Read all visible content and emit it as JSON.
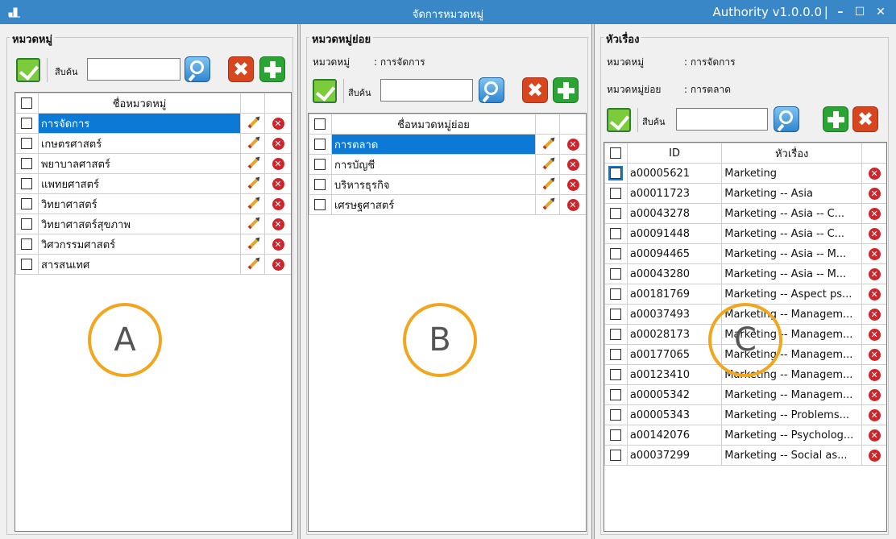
{
  "window": {
    "title": "จัดการหมวดหมู่",
    "version": "Authority v1.0.0.0",
    "separator": "|",
    "min_label": "–",
    "max_label": "☐",
    "close_label": "✕"
  },
  "panel_a": {
    "group_title": "หมวดหมู่",
    "search_label": "สืบค้น",
    "search_value": "",
    "delete_label": "✖",
    "header": "ชื่อหมวดหมู่",
    "rows": [
      {
        "name": "การจัดการ",
        "selected": true
      },
      {
        "name": "เกษตรศาสตร์"
      },
      {
        "name": "พยาบาลศาสตร์"
      },
      {
        "name": "แพทยศาสตร์"
      },
      {
        "name": "วิทยาศาสตร์"
      },
      {
        "name": "วิทยาศาสตร์สุขภาพ"
      },
      {
        "name": "วิศวกรรมศาสตร์"
      },
      {
        "name": "สารสนเทศ"
      }
    ],
    "overlay": "A"
  },
  "panel_b": {
    "group_title": "หมวดหมู่ย่อย",
    "category_key": "หมวดหมู่",
    "category_value": ": การจัดการ",
    "search_label": "สืบค้น",
    "search_value": "",
    "delete_label": "✖",
    "header": "ชื่อหมวดหมู่ย่อย",
    "rows": [
      {
        "name": "การตลาด",
        "selected": true
      },
      {
        "name": "การบัญชี"
      },
      {
        "name": "บริหารธุรกิจ"
      },
      {
        "name": "เศรษฐศาสตร์"
      }
    ],
    "overlay": "B"
  },
  "panel_c": {
    "group_title": "หัวเรื่อง",
    "category_key": "หมวดหมู่",
    "category_value": ": การจัดการ",
    "subcategory_key": "หมวดหมู่ย่อย",
    "subcategory_value": ": การตลาด",
    "search_label": "สืบค้น",
    "search_value": "",
    "delete_label": "✖",
    "header_id": "ID",
    "header_subject": "หัวเรื่อง",
    "rows": [
      {
        "id": "a00005621",
        "subject": "Marketing"
      },
      {
        "id": "a00011723",
        "subject": "Marketing -- Asia"
      },
      {
        "id": "a00043278",
        "subject": "Marketing -- Asia -- C..."
      },
      {
        "id": "a00091448",
        "subject": "Marketing -- Asia -- C..."
      },
      {
        "id": "a00094465",
        "subject": "Marketing -- Asia -- M..."
      },
      {
        "id": "a00043280",
        "subject": "Marketing -- Asia -- M..."
      },
      {
        "id": "a00181769",
        "subject": "Marketing -- Aspect ps..."
      },
      {
        "id": "a00037493",
        "subject": "Marketing -- Managem..."
      },
      {
        "id": "a00028173",
        "subject": "Marketing -- Managem..."
      },
      {
        "id": "a00177065",
        "subject": "Marketing -- Managem..."
      },
      {
        "id": "a00123410",
        "subject": "Marketing -- Managem..."
      },
      {
        "id": "a00005342",
        "subject": "Marketing -- Managem..."
      },
      {
        "id": "a00005343",
        "subject": "Marketing -- Problems..."
      },
      {
        "id": "a00142076",
        "subject": "Marketing -- Psycholog..."
      },
      {
        "id": "a00037299",
        "subject": "Marketing -- Social as..."
      }
    ],
    "overlay": "C"
  },
  "colors": {
    "titlebar": "#3a87c8",
    "selection": "#0c79d6",
    "overlay_ring": "#f2a51f"
  }
}
